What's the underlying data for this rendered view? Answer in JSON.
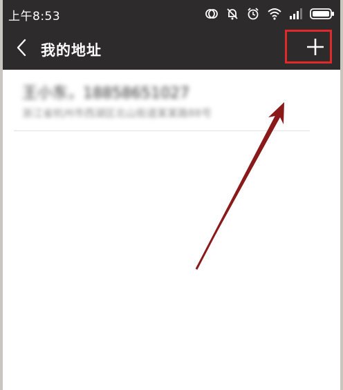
{
  "status_bar": {
    "time": "上午8:53",
    "icons": [
      "sync-icon",
      "notification-off-icon",
      "alarm-icon",
      "wifi-icon",
      "signal-icon",
      "battery-icon"
    ]
  },
  "header": {
    "title": "我的地址",
    "back_icon": "chevron-left-icon",
    "add_icon": "plus-icon"
  },
  "addresses": [
    {
      "name_phone": "王小东，18858651027",
      "address": "浙江省杭州市西湖区北山街道某某路88号"
    }
  ],
  "colors": {
    "bar": "#2d2b2c",
    "highlight": "#e02a2a",
    "arrow": "#8a1a1a",
    "divider": "#e3e3e3"
  }
}
